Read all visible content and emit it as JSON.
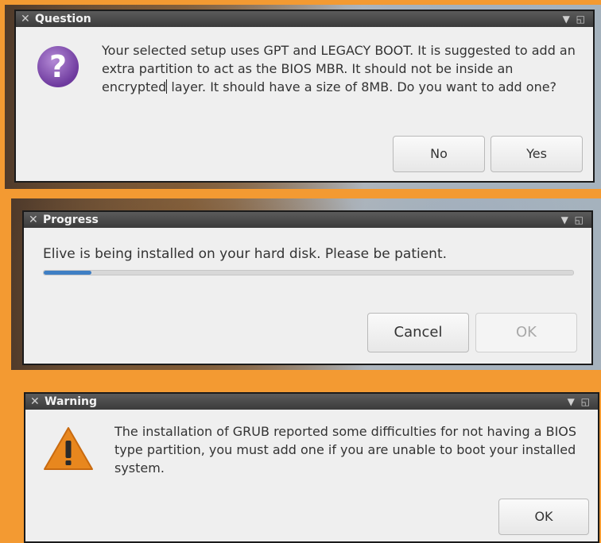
{
  "question": {
    "title": "Question",
    "message_part1": "Your selected setup uses GPT and LEGACY BOOT. It is suggested to add an extra partition to act as the BIOS MBR. It should not be inside an encrypted",
    "message_part2": "layer. It should have a size of 8MB. Do you want to add one?",
    "no_label": "No",
    "yes_label": "Yes",
    "icon": "question-icon"
  },
  "progress": {
    "title": "Progress",
    "message": "Elive is being installed on your hard disk. Please be patient.",
    "percent": 9,
    "cancel_label": "Cancel",
    "ok_label": "OK"
  },
  "warning": {
    "title": "Warning",
    "message": "The installation of GRUB reported some difficulties for not having a BIOS type partition, you must add one if you are unable to boot your installed system.",
    "ok_label": "OK",
    "icon": "warning-icon"
  },
  "colors": {
    "frame": "#f39a32",
    "progress_fill": "#3f7fc4",
    "question_icon": "#7a44a8",
    "warning_icon": "#e8871e"
  }
}
